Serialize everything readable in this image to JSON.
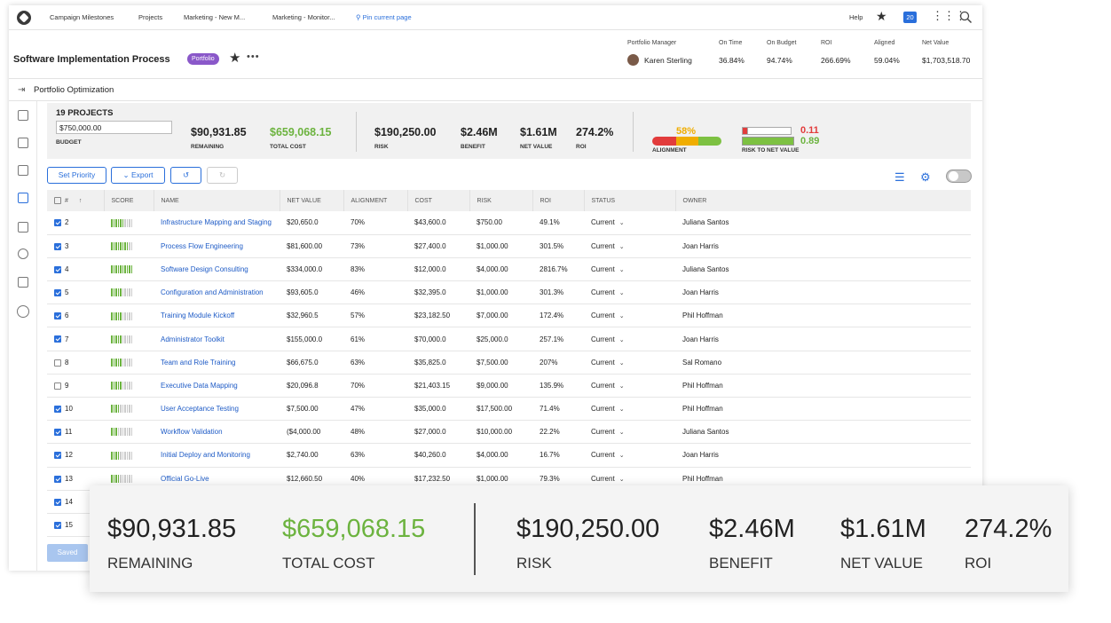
{
  "nav": {
    "links": [
      "Campaign Milestones",
      "Projects",
      "Marketing - New M...",
      "Marketing - Monitor..."
    ],
    "pin": "Pin current page",
    "help": "Help",
    "notifications": "20",
    "icons": [
      "logo-icon",
      "star-icon",
      "apps-grid-icon",
      "search-icon"
    ]
  },
  "header": {
    "title": "Software Implementation Process",
    "badge": "Portfolio",
    "manager_label": "Portfolio Manager",
    "manager_name": "Karen Sterling",
    "kpis": [
      {
        "label": "On Time",
        "value": "36.84%"
      },
      {
        "label": "On Budget",
        "value": "94.74%"
      },
      {
        "label": "ROI",
        "value": "266.69%"
      },
      {
        "label": "Aligned",
        "value": "59.04%"
      },
      {
        "label": "Net Value",
        "value": "$1,703,518.70"
      }
    ]
  },
  "breadcrumb": "Portfolio Optimization",
  "summary": {
    "projects": "19 PROJECTS",
    "budget_value": "$750,000.00",
    "budget_label": "BUDGET",
    "remaining": "$90,931.85",
    "remaining_label": "REMAINING",
    "total_cost": "$659,068.15",
    "total_cost_label": "TOTAL COST",
    "risk": "$190,250.00",
    "risk_label": "RISK",
    "benefit": "$2.46M",
    "benefit_label": "BENEFIT",
    "net_value": "$1.61M",
    "net_value_label": "NET VALUE",
    "roi": "274.2%",
    "roi_label": "ROI",
    "alignment_value": "58%",
    "alignment_label": "ALIGNMENT",
    "risk_net_1": "0.11",
    "risk_net_2": "0.89",
    "risk_net_label": "RISK TO NET VALUE",
    "colors": {
      "green": "#6cb33f",
      "red": "#e23c3c",
      "amber": "#f0ad00"
    }
  },
  "toolbar": {
    "set_priority": "Set Priority",
    "export": "Export",
    "saved": "Saved"
  },
  "table": {
    "headers": [
      "#",
      "SCORE",
      "NAME",
      "NET VALUE",
      "ALIGNMENT",
      "COST",
      "RISK",
      "ROI",
      "STATUS",
      "OWNER"
    ],
    "rows": [
      {
        "n": "2",
        "checked": true,
        "score": 6,
        "name": "Infrastructure Mapping and Staging",
        "net": "$20,650.0",
        "align": "70%",
        "cost": "$43,600.0",
        "risk": "$750.00",
        "roi": "49.1%",
        "status": "Current",
        "owner": "Juliana Santos"
      },
      {
        "n": "3",
        "checked": true,
        "score": 8,
        "name": "Process Flow Engineering",
        "net": "$81,600.00",
        "align": "73%",
        "cost": "$27,400.0",
        "risk": "$1,000.00",
        "roi": "301.5%",
        "status": "Current",
        "owner": "Joan Harris"
      },
      {
        "n": "4",
        "checked": true,
        "score": 10,
        "name": "Software Design Consulting",
        "net": "$334,000.0",
        "align": "83%",
        "cost": "$12,000.0",
        "risk": "$4,000.00",
        "roi": "2816.7%",
        "status": "Current",
        "owner": "Juliana Santos"
      },
      {
        "n": "5",
        "checked": true,
        "score": 5,
        "name": "Configuration and Administration",
        "net": "$93,605.0",
        "align": "46%",
        "cost": "$32,395.0",
        "risk": "$1,000.00",
        "roi": "301.3%",
        "status": "Current",
        "owner": "Joan Harris"
      },
      {
        "n": "6",
        "checked": true,
        "score": 5,
        "name": "Training Module Kickoff",
        "net": "$32,960.5",
        "align": "57%",
        "cost": "$23,182.50",
        "risk": "$7,000.00",
        "roi": "172.4%",
        "status": "Current",
        "owner": "Phil Hoffman"
      },
      {
        "n": "7",
        "checked": true,
        "score": 5,
        "name": "Administrator Toolkit",
        "net": "$155,000.0",
        "align": "61%",
        "cost": "$70,000.0",
        "risk": "$25,000.0",
        "roi": "257.1%",
        "status": "Current",
        "owner": "Joan Harris"
      },
      {
        "n": "8",
        "checked": false,
        "score": 5,
        "name": "Team and Role Training",
        "net": "$66,675.0",
        "align": "63%",
        "cost": "$35,825.0",
        "risk": "$7,500.00",
        "roi": "207%",
        "status": "Current",
        "owner": "Sal Romano"
      },
      {
        "n": "9",
        "checked": false,
        "score": 5,
        "name": "Executive Data Mapping",
        "net": "$20,096.8",
        "align": "70%",
        "cost": "$21,403.15",
        "risk": "$9,000.00",
        "roi": "135.9%",
        "status": "Current",
        "owner": "Phil Hoffman"
      },
      {
        "n": "10",
        "checked": true,
        "score": 4,
        "name": "User Acceptance Testing",
        "net": "$7,500.00",
        "align": "47%",
        "cost": "$35,000.0",
        "risk": "$17,500.00",
        "roi": "71.4%",
        "status": "Current",
        "owner": "Phil Hoffman"
      },
      {
        "n": "11",
        "checked": true,
        "score": 3,
        "name": "Workflow Validation",
        "net": "($4,000.00",
        "align": "48%",
        "cost": "$27,000.0",
        "risk": "$10,000.00",
        "roi": "22.2%",
        "status": "Current",
        "owner": "Juliana Santos"
      },
      {
        "n": "12",
        "checked": true,
        "score": 4,
        "name": "Initial Deploy and Monitoring",
        "net": "$2,740.00",
        "align": "63%",
        "cost": "$40,260.0",
        "risk": "$4,000.00",
        "roi": "16.7%",
        "status": "Current",
        "owner": "Joan Harris"
      },
      {
        "n": "13",
        "checked": true,
        "score": 4,
        "name": "Official Go-Live",
        "net": "$12,660.50",
        "align": "40%",
        "cost": "$17,232.50",
        "risk": "$1,000.00",
        "roi": "79.3%",
        "status": "Current",
        "owner": "Phil Hoffman"
      },
      {
        "n": "14",
        "checked": true,
        "score": 0,
        "name": "",
        "net": "",
        "align": "",
        "cost": "",
        "risk": "",
        "roi": "",
        "status": "",
        "owner": ""
      },
      {
        "n": "15",
        "checked": true,
        "score": 0,
        "name": "",
        "net": "",
        "align": "",
        "cost": "",
        "risk": "",
        "roi": "",
        "status": "",
        "owner": ""
      }
    ]
  },
  "overlay": {
    "remaining": "$90,931.85",
    "remaining_label": "REMAINING",
    "total_cost": "$659,068.15",
    "total_cost_label": "TOTAL COST",
    "risk": "$190,250.00",
    "risk_label": "RISK",
    "benefit": "$2.46M",
    "benefit_label": "BENEFIT",
    "net_value": "$1.61M",
    "net_value_label": "NET VALUE",
    "roi": "274.2%",
    "roi_label": "ROI"
  }
}
